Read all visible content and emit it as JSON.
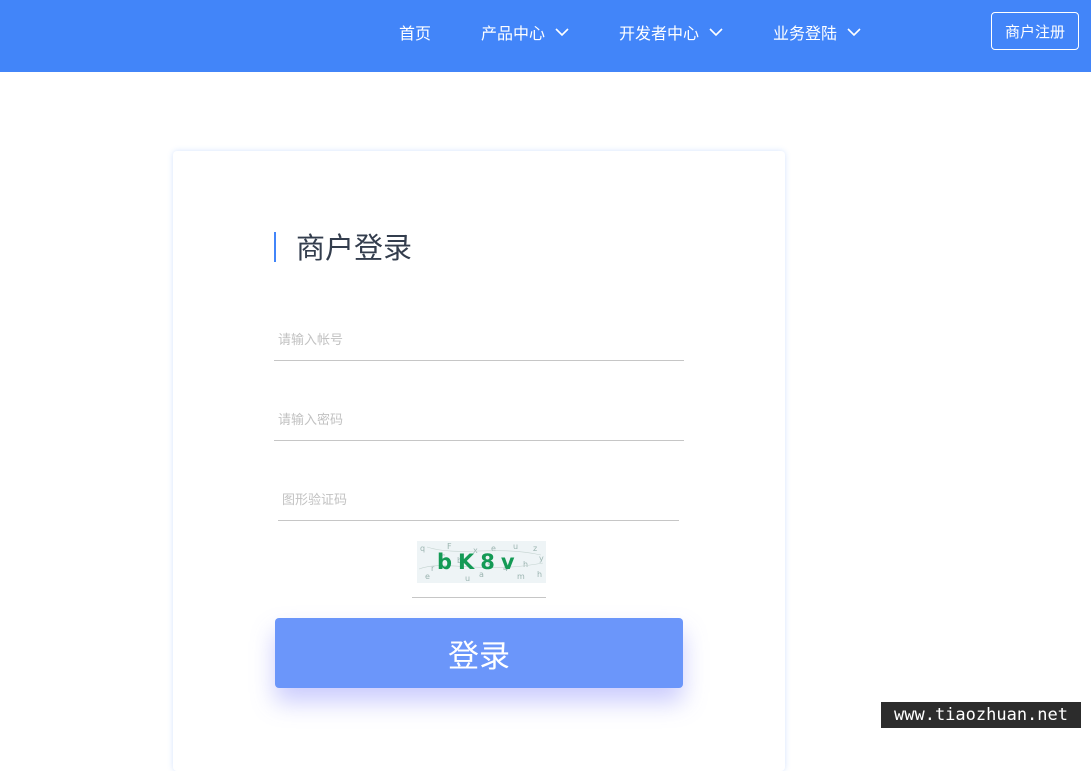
{
  "header": {
    "nav": {
      "home": "首页",
      "products": "产品中心",
      "developer": "开发者中心",
      "business_login": "业务登陆"
    },
    "register_label": "商户注册",
    "bg_color": "#4285f9"
  },
  "login": {
    "title": "商户登录",
    "account_placeholder": "请输入帐号",
    "password_placeholder": "请输入密码",
    "captcha_placeholder": "图形验证码",
    "captcha_text": "bK8v",
    "submit_label": "登录",
    "button_color": "#6b96fa"
  },
  "watermark": "www.tiaozhuan.net",
  "icons": [
    "chevron-down-icon"
  ]
}
